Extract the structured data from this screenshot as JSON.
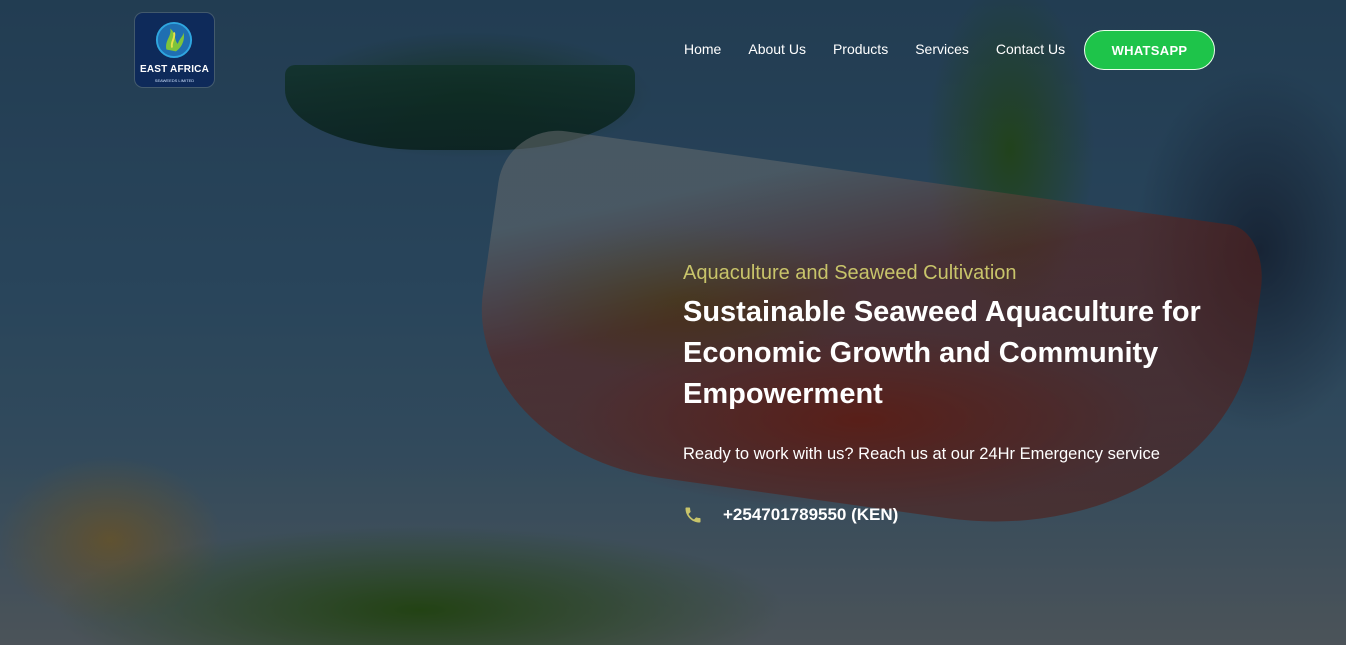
{
  "brand": {
    "logo_text": "EAST AFRICA",
    "logo_subtext": "SEAWEEDS LIMITED"
  },
  "nav": {
    "items": [
      "Home",
      "About Us",
      "Products",
      "Services",
      "Contact Us"
    ],
    "cta_label": "WHATSAPP"
  },
  "hero": {
    "kicker": "Aquaculture and Seaweed Cultivation",
    "headline": "Sustainable Seaweed Aquaculture for Economic Growth and Community Empowerment",
    "lead": "Ready to work with us? Reach us at our 24Hr Emergency service",
    "phone_icon": "phone-icon",
    "phone": "+254701789550 (KEN)"
  },
  "colors": {
    "accent": "#c8c46a",
    "cta": "#1ec44a",
    "logo_bg": "#0e2a5a"
  }
}
